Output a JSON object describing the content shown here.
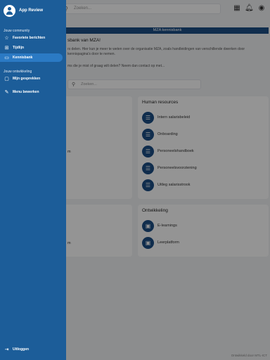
{
  "background": {
    "search_placeholder": "Zoeken...",
    "banner": "MZA kennisbank",
    "intro_title": "sbank van MZA!",
    "intro_text": "rs delen. Hier kun je meer te weten over de organisatie MZA, zoals handleidingen van verschillende dwerken door kennispagina's door te nemen.",
    "intro_question": "ms die je mist of graag wilt delen? Neem dan contact op met...",
    "search2_placeholder": "Zoeken...",
    "hr_card": {
      "title": "Human resources",
      "items": [
        "Intern salarisbeleid",
        "Onboarding",
        "Personeelshandboek",
        "Personeelsvoorziening",
        "Uitleg salarisstrook"
      ]
    },
    "dev_card": {
      "title": "Ontwikkeling",
      "items": [
        "E-learnings",
        "Leerplatform"
      ]
    },
    "left_card_item1": "m",
    "left_card_item2": "m",
    "footer": "Ontwikkeld door MTL-ICT"
  },
  "drawer": {
    "app_title": "App Review",
    "section1": "Jouw community",
    "items1": [
      {
        "label": "Favoriete berichten",
        "icon": "star-icon"
      },
      {
        "label": "Tijdlijn",
        "icon": "map-icon"
      },
      {
        "label": "Kennisbank",
        "icon": "book-icon"
      }
    ],
    "section2": "Jouw ontwikkeling",
    "items2": [
      {
        "label": "Mijn gesprekken",
        "icon": "chat-icon"
      }
    ],
    "edit_menu": "Menu bewerken",
    "logout": "Uitloggen"
  },
  "colors": {
    "drawer": "#1c5d99",
    "active": "#2b7ac4",
    "brand": "#1c4e86"
  }
}
